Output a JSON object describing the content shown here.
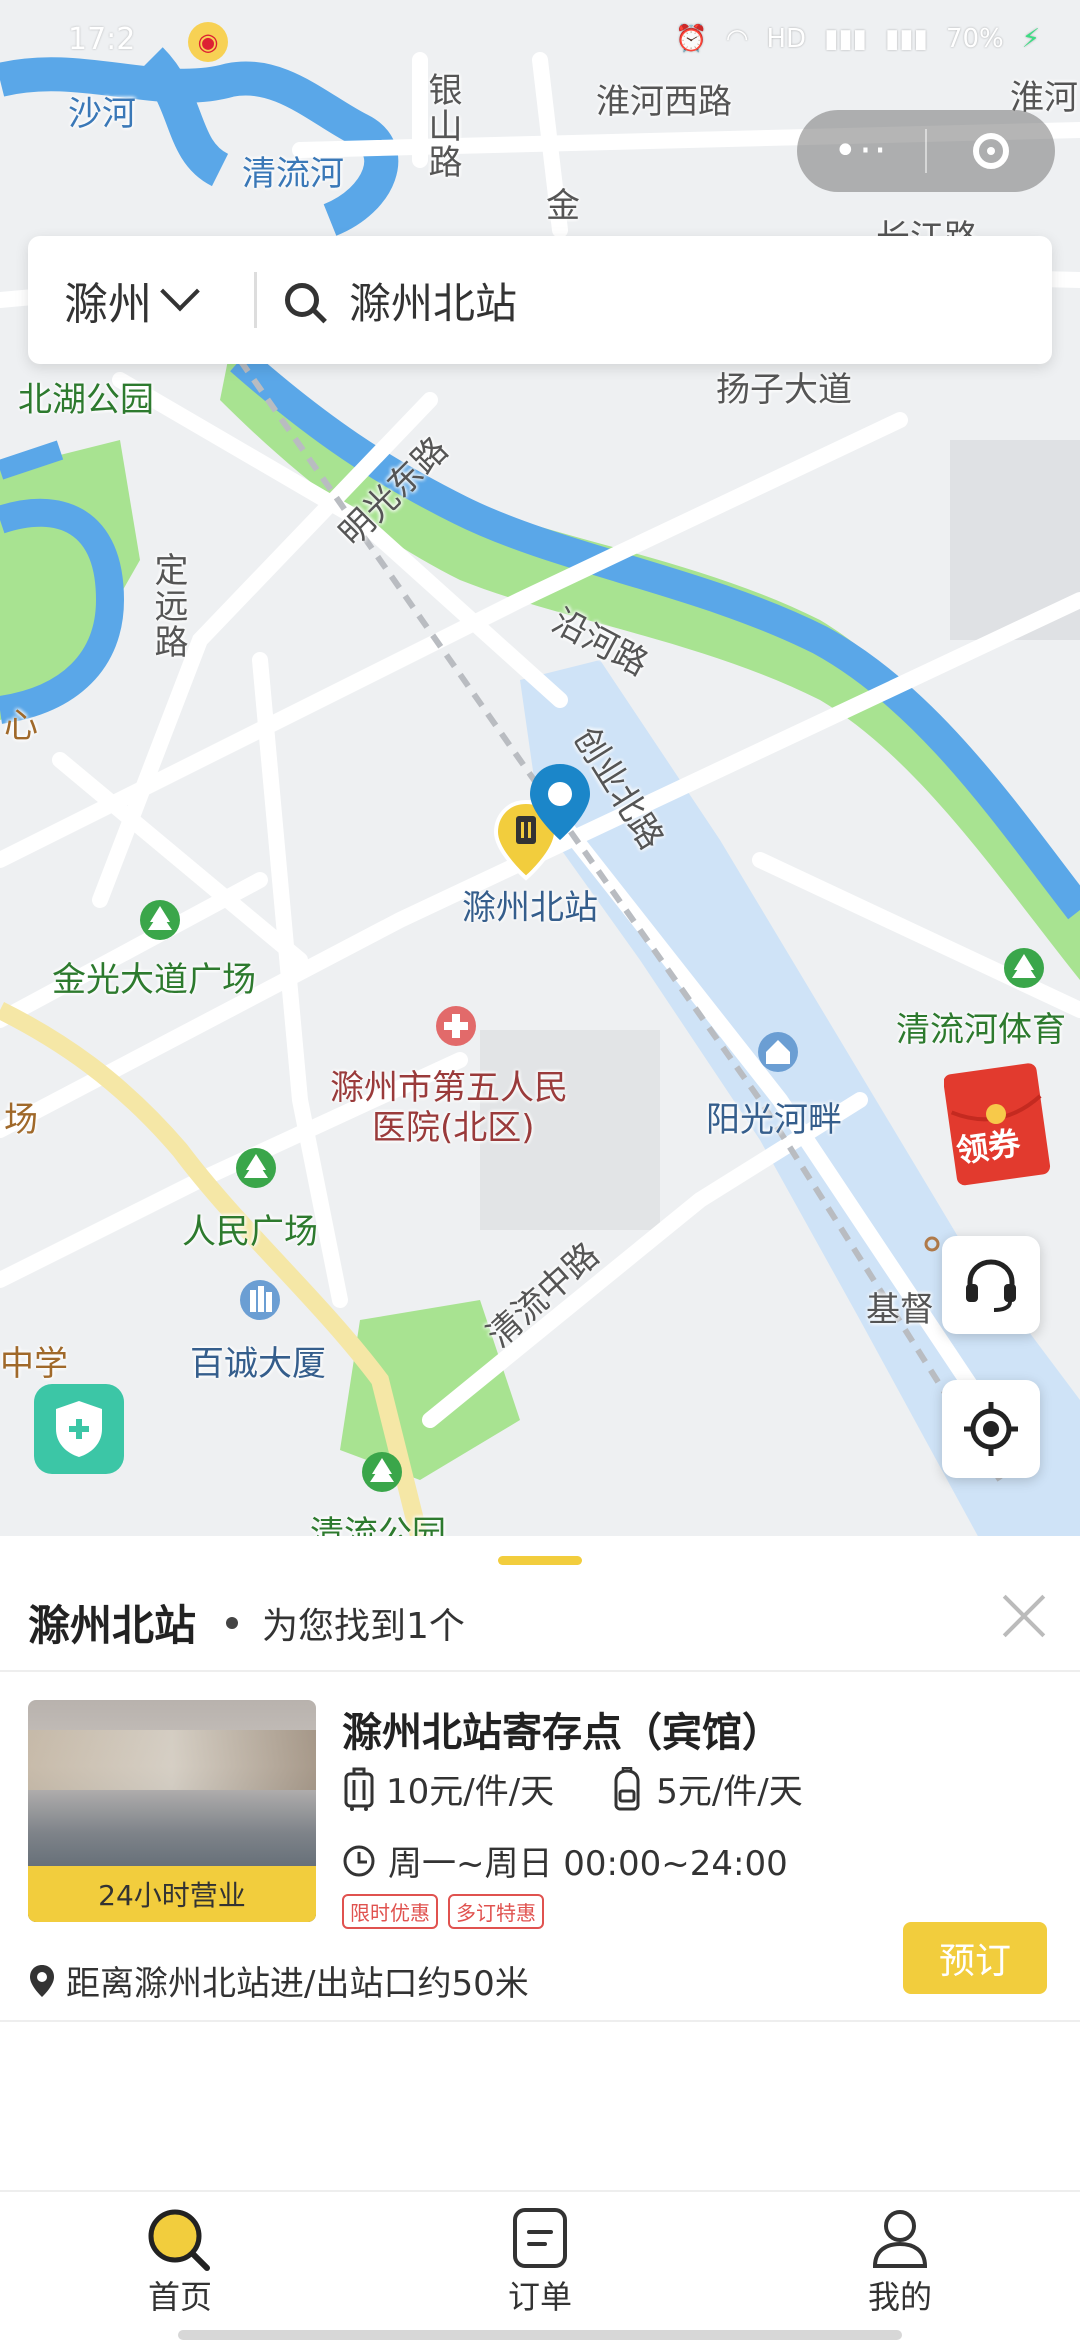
{
  "status": {
    "time": "17:2",
    "battery": "70%"
  },
  "capsule": {
    "more_label": "•··"
  },
  "search": {
    "city": "滁州",
    "query": "滁州北站"
  },
  "map": {
    "labels": {
      "shahe": "沙河",
      "qingliuhe": "清流河",
      "yinshanlu": "银山路",
      "huaihexilu": "淮河西路",
      "huaihe_cut": "淮河",
      "jinlu": "金",
      "changjianglu_cut": "长江路",
      "beihugongyuan": "北湖公园",
      "yangzidadao": "扬子大道",
      "mingguangdonglu": "明光东路",
      "yanhelu": "沿河路",
      "dingyuanlu": "定远路",
      "xin": "心",
      "chuangyebeilu": "创业北路",
      "station": "滁州北站",
      "jinguangdadaoguangchang": "金光大道广场",
      "qingliuhetiyu": "清流河体育",
      "hospital_line1": "滁州市第五人民",
      "hospital_line2": "医院(北区)",
      "yangguanghepan": "阳光河畔",
      "chang": "场",
      "renminguangchang": "人民广场",
      "qingliuzhonglu": "清流中路",
      "jidu": "基督",
      "zhongxue": "中学",
      "baichengdasha": "百诚大厦",
      "qingliugongyuan": "清流公园"
    },
    "coupon_label": "领券"
  },
  "sheet": {
    "title": "滁州北站",
    "result_text": "为您找到1个",
    "store": {
      "name": "滁州北站寄存点（宾馆）",
      "badge": "24小时营业",
      "price_large": "10元/件/天",
      "price_small": "5元/件/天",
      "hours": "周一~周日 00:00~24:00",
      "tags": [
        "限时优惠",
        "多订特惠"
      ],
      "distance": "距离滁州北站进/出站口约50米",
      "book_label": "预订"
    }
  },
  "tabs": [
    {
      "label": "首页",
      "icon": "search-icon"
    },
    {
      "label": "订单",
      "icon": "order-icon"
    },
    {
      "label": "我的",
      "icon": "profile-icon"
    }
  ],
  "colors": {
    "accent": "#f2cd3d",
    "water": "#5aa7e8",
    "park": "#9fe38a",
    "tag": "#e0524f"
  }
}
